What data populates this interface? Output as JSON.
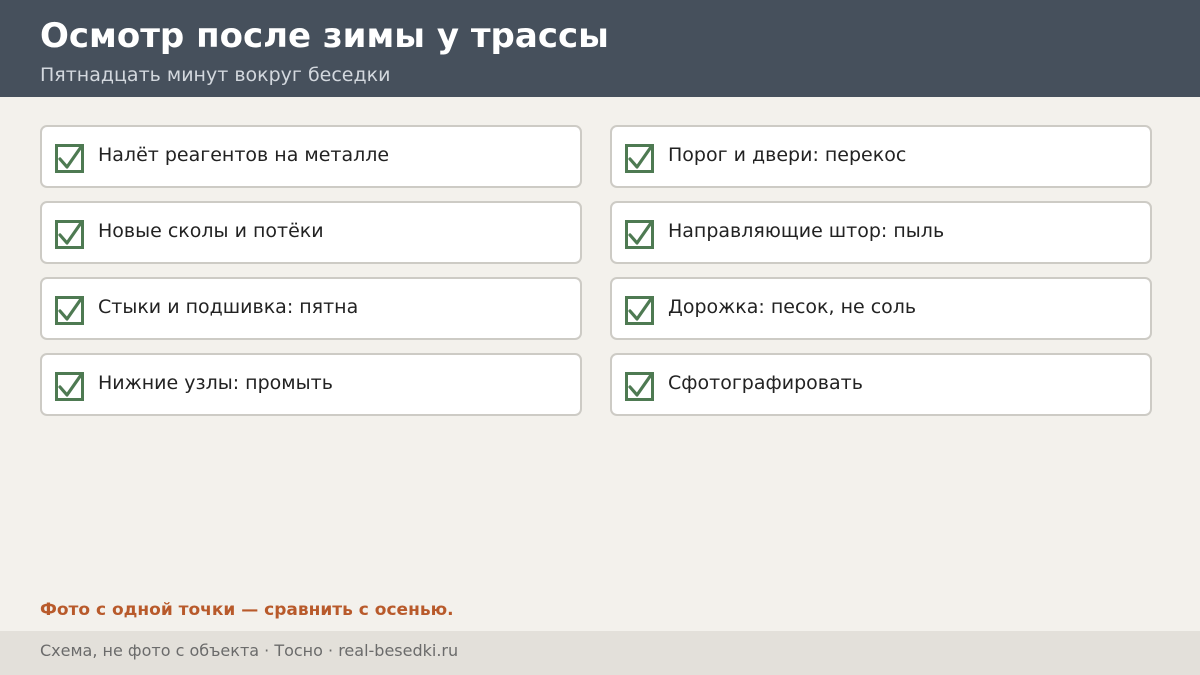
{
  "header": {
    "title": "Осмотр после зимы у трассы",
    "subtitle": "Пятнадцать минут вокруг беседки"
  },
  "checklist": {
    "left": [
      {
        "label": "Налёт реагентов на металле",
        "checked": true
      },
      {
        "label": "Новые сколы и потёки",
        "checked": true
      },
      {
        "label": "Стыки и подшивка: пятна",
        "checked": true
      },
      {
        "label": "Нижние узлы: промыть",
        "checked": true
      }
    ],
    "right": [
      {
        "label": "Порог и двери: перекос",
        "checked": true
      },
      {
        "label": "Направляющие штор: пыль",
        "checked": true
      },
      {
        "label": "Дорожка: песок, не соль",
        "checked": true
      },
      {
        "label": "Сфотографировать",
        "checked": true
      }
    ]
  },
  "note": "Фото с одной точки — сравнить с осенью.",
  "footer": {
    "text": "Схема, не фото с объекта  ·  Тосно  ·  real-besedki.ru"
  },
  "colors": {
    "header_bg": "#46505c",
    "checkbox": "#4e7a52",
    "accent": "#b85a2b",
    "page_bg": "#f3f1ec",
    "footer_bg": "#e3e0da"
  },
  "icons": {
    "checkbox": "checkbox-checked-icon"
  }
}
